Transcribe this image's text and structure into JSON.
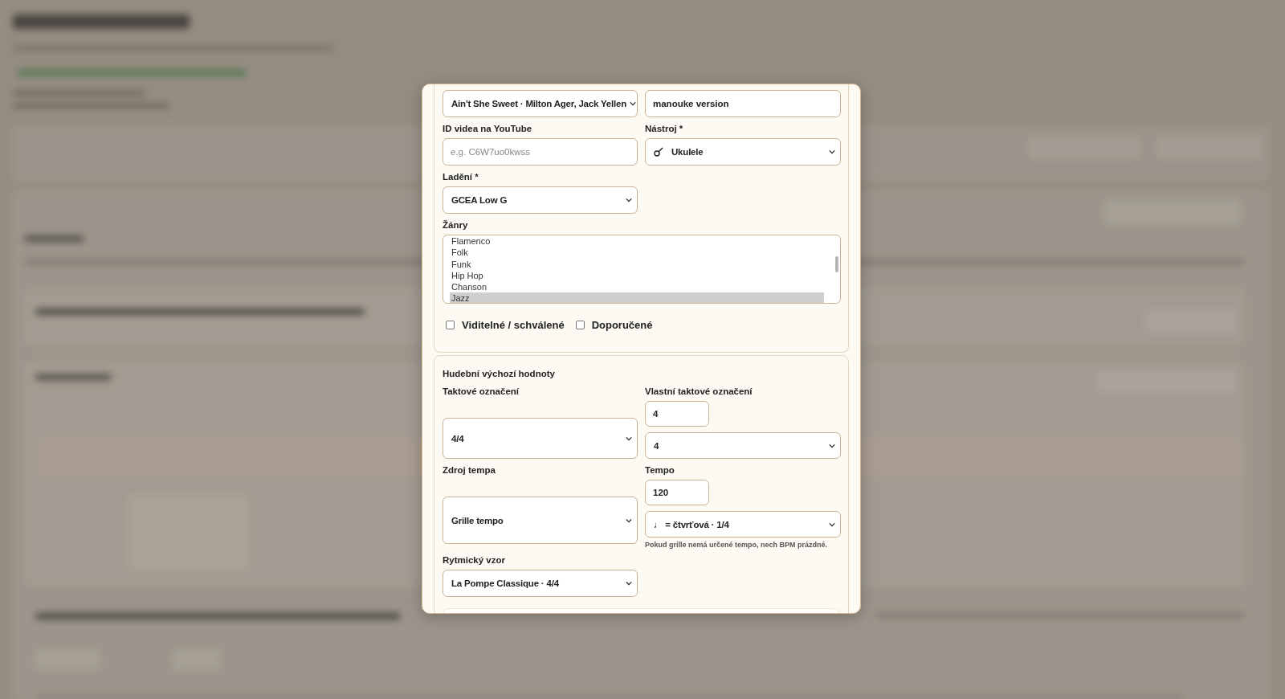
{
  "dialog": {
    "song": {
      "value": "Ain't She Sweet · Milton Ager, Jack Yellen"
    },
    "version_name": {
      "value": "manouke version"
    },
    "youtube_id": {
      "label": "ID videa na YouTube",
      "placeholder": "e.g. C6W7uo0kwss"
    },
    "instrument": {
      "label": "Nástroj *",
      "value": "Ukulele"
    },
    "tuning": {
      "label": "Ladění *",
      "value": "GCEA Low G"
    },
    "genres": {
      "label": "Žánry",
      "options": [
        {
          "label": "Flamenco",
          "selected": false
        },
        {
          "label": "Folk",
          "selected": false
        },
        {
          "label": "Funk",
          "selected": false
        },
        {
          "label": "Hip Hop",
          "selected": false
        },
        {
          "label": "Chanson",
          "selected": false
        },
        {
          "label": "Jazz",
          "selected": true
        }
      ]
    },
    "flags": [
      {
        "label": "Viditelné / schválené",
        "checked": false
      },
      {
        "label": "Doporučené",
        "checked": false
      }
    ],
    "music_defaults": {
      "title": "Hudební výchozí hodnoty",
      "time_signature": {
        "label": "Taktové označení",
        "value": "4/4"
      },
      "custom_time_signature": {
        "label": "Vlastní taktové označení",
        "numerator": "4",
        "denominator": "4"
      },
      "tempo_source": {
        "label": "Zdroj tempa",
        "value": "Grille tempo"
      },
      "tempo": {
        "label": "Tempo",
        "value": "120",
        "unit": "♩ = čtvrťová · 1/4",
        "hint": "Pokud grille nemá určené tempo, nech BPM prázdné."
      },
      "rhythm_pattern": {
        "label": "Rytmický vzor",
        "value": "La Pompe Classique · 4/4"
      }
    }
  }
}
